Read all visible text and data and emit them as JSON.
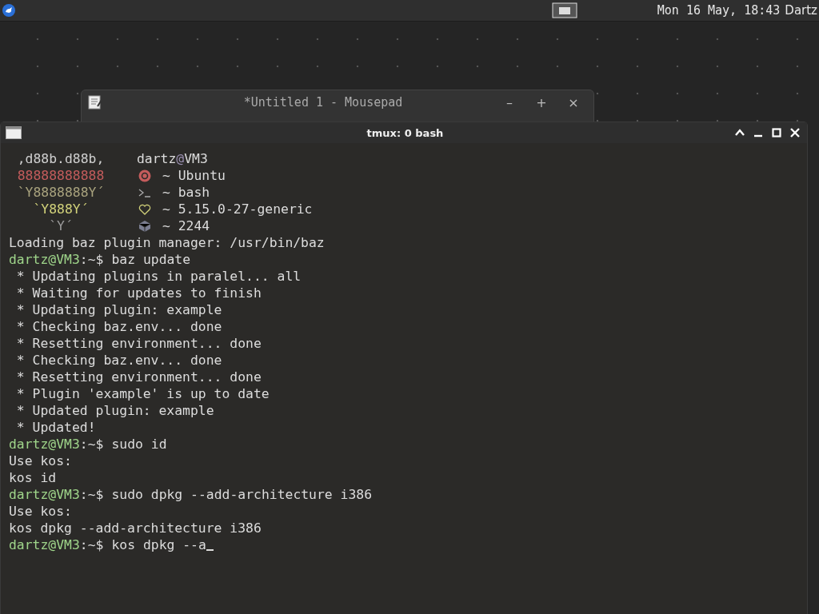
{
  "panel": {
    "clock": "Mon 16 May, 18:43",
    "user": "Dartz"
  },
  "background_window": {
    "title": "*Untitled 1 - Mousepad",
    "buttons": [
      "–",
      "+",
      "×"
    ]
  },
  "terminal": {
    "title": "tmux: 0 bash",
    "fetch": [
      {
        "art": ",d88b.d88b,",
        "color": "#d0d0d0",
        "kind": "host",
        "user": "dartz",
        "at": "@",
        "host": "VM3"
      },
      {
        "art": "88888888888",
        "color": "#c45c5c",
        "kind": "info",
        "text": "~ Ubuntu"
      },
      {
        "art": "`Y8888888Y´",
        "color": "#a9a37e",
        "kind": "info",
        "text": "~ bash"
      },
      {
        "art": "`Y888Y´",
        "color": "#d2d27a",
        "kind": "info",
        "text": "~ 5.15.0-27-generic"
      },
      {
        "art": "`Y´",
        "color": "#9a9a9a",
        "kind": "info",
        "text": "~ 2244"
      }
    ],
    "lines": [
      {
        "kind": "output",
        "text": "Loading baz plugin manager: /usr/bin/baz"
      },
      {
        "kind": "prompt",
        "prompt": "dartz@VM3",
        "sep": ":~$",
        "command": "baz update",
        "cursor": false
      },
      {
        "kind": "output",
        "text": " * Updating plugins in paralel... all"
      },
      {
        "kind": "output",
        "text": " * Waiting for updates to finish"
      },
      {
        "kind": "output",
        "text": " * Updating plugin: example"
      },
      {
        "kind": "output",
        "text": " * Checking baz.env... done"
      },
      {
        "kind": "output",
        "text": " * Resetting environment... done"
      },
      {
        "kind": "output",
        "text": " * Checking baz.env... done"
      },
      {
        "kind": "output",
        "text": " * Resetting environment... done"
      },
      {
        "kind": "output",
        "text": " * Plugin 'example' is up to date"
      },
      {
        "kind": "output",
        "text": " * Updated plugin: example"
      },
      {
        "kind": "output",
        "text": " * Updated!"
      },
      {
        "kind": "prompt",
        "prompt": "dartz@VM3",
        "sep": ":~$",
        "command": "sudo id",
        "cursor": false
      },
      {
        "kind": "output",
        "text": "Use kos:"
      },
      {
        "kind": "output",
        "text": "kos id"
      },
      {
        "kind": "prompt",
        "prompt": "dartz@VM3",
        "sep": ":~$",
        "command": "sudo dpkg --add-architecture i386",
        "cursor": false
      },
      {
        "kind": "output",
        "text": "Use kos:"
      },
      {
        "kind": "output",
        "text": "kos dpkg --add-architecture i386"
      },
      {
        "kind": "prompt",
        "prompt": "dartz@VM3",
        "sep": ":~$",
        "command": "kos dpkg --a",
        "cursor": true
      }
    ]
  }
}
